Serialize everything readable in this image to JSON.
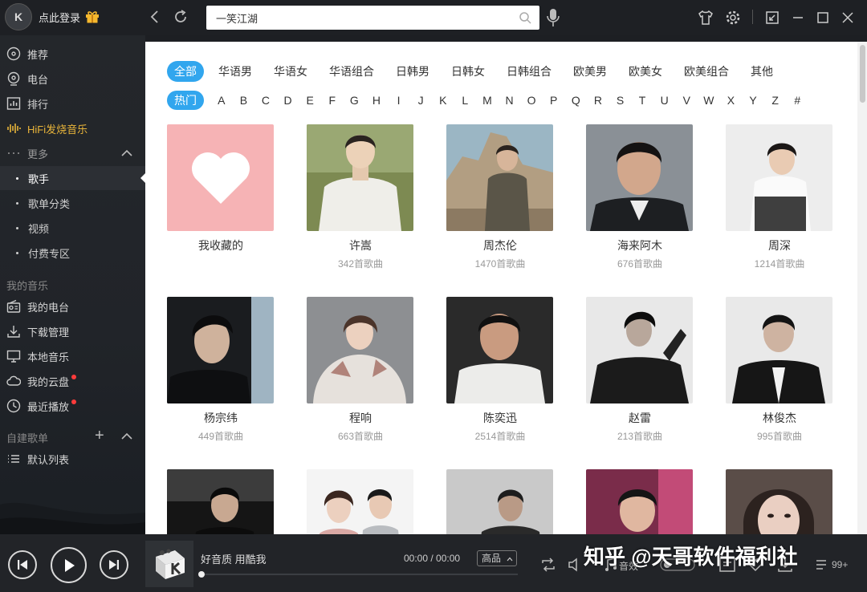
{
  "header": {
    "login_text": "点此登录",
    "avatar_letter": "K",
    "search_value": "一笑江湖"
  },
  "sidebar": {
    "items": [
      {
        "label": "推荐",
        "icon": "disc-icon"
      },
      {
        "label": "电台",
        "icon": "radio-icon"
      },
      {
        "label": "排行",
        "icon": "chart-icon"
      },
      {
        "label": "HiFi发烧音乐",
        "icon": "soundwave-icon"
      }
    ],
    "more_label": "更多",
    "more_sub": [
      "歌手",
      "歌单分类",
      "视频",
      "付费专区"
    ],
    "my_music_title": "我的音乐",
    "my_music": [
      {
        "label": "我的电台",
        "icon": "radio-box-icon"
      },
      {
        "label": "下载管理",
        "icon": "download-icon"
      },
      {
        "label": "本地音乐",
        "icon": "monitor-icon"
      },
      {
        "label": "我的云盘",
        "icon": "cloud-icon"
      },
      {
        "label": "最近播放",
        "icon": "clock-icon"
      }
    ],
    "playlist_title": "自建歌单",
    "playlists": [
      "默认列表"
    ]
  },
  "filters": {
    "categories": [
      "全部",
      "华语男",
      "华语女",
      "华语组合",
      "日韩男",
      "日韩女",
      "日韩组合",
      "欧美男",
      "欧美女",
      "欧美组合",
      "其他"
    ],
    "hot_label": "热门",
    "letters": [
      "A",
      "B",
      "C",
      "D",
      "E",
      "F",
      "G",
      "H",
      "I",
      "J",
      "K",
      "L",
      "M",
      "N",
      "O",
      "P",
      "Q",
      "R",
      "S",
      "T",
      "U",
      "V",
      "W",
      "X",
      "Y",
      "Z",
      "#"
    ]
  },
  "artists": [
    {
      "name": "我收藏的",
      "count": ""
    },
    {
      "name": "许嵩",
      "count": "342首歌曲"
    },
    {
      "name": "周杰伦",
      "count": "1470首歌曲"
    },
    {
      "name": "海来阿木",
      "count": "676首歌曲"
    },
    {
      "name": "周深",
      "count": "1214首歌曲"
    },
    {
      "name": "杨宗纬",
      "count": "449首歌曲"
    },
    {
      "name": "程响",
      "count": "663首歌曲"
    },
    {
      "name": "陈奕迅",
      "count": "2514首歌曲"
    },
    {
      "name": "赵雷",
      "count": "213首歌曲"
    },
    {
      "name": "林俊杰",
      "count": "995首歌曲"
    }
  ],
  "player": {
    "song": "好音质 用酷我",
    "time": "00:00 / 00:00",
    "quality": "高品",
    "sound_label": "音效",
    "badge": "99+"
  },
  "watermark": "知乎 @天哥软件福利社",
  "colors": {
    "accent": "#31a6ee",
    "hifi": "#e8b43a",
    "sidebar_bg": "#222529",
    "fav_pink": "#f6b3b5"
  }
}
